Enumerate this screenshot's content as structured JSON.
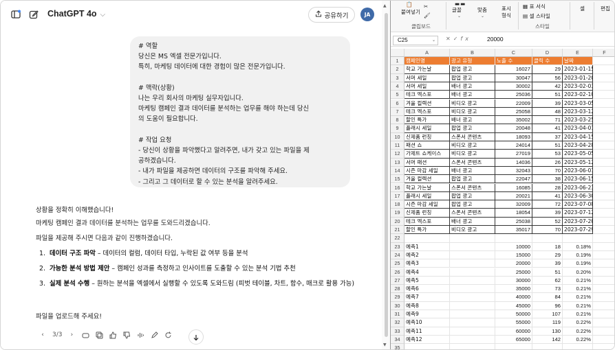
{
  "chat": {
    "model_name": "ChatGPT 4o",
    "share_label": "공유하기",
    "avatar_initials": "JA",
    "user_message_lines": [
      "# 역할",
      "당신은 MS 엑셀 전문가입니다.",
      "특히, 마케팅 데이터에 대한 경험이 많은 전문가입니다.",
      "",
      "# 맥락(상황)",
      "나는 우리 회사의 마케팅 실무자입니다.",
      "마케팅 캠페인 결과 데이터를 분석하는 업무를 해야 하는데 당신",
      "의 도움이 필요합니다.",
      "",
      "# 작업 요청",
      "- 당신이 상황을 파악했다고 알려주면, 내가 갖고 있는 파일을 제",
      "공하겠습니다.",
      "- 내가 파일을 제공하면 데이터의 구조를 파악해 주세요.",
      "- 그리고 그 데이터로 할 수 있는 분석을 알려주세요."
    ],
    "answer_intro_lines": [
      "상황을 정확히 이해했습니다!",
      "마케팅 캠페인 결과 데이터를 분석하는 업무를 도와드리겠습니다."
    ],
    "answer_plan_line": "파일을 제공해 주시면 다음과 같이 진행하겠습니다.",
    "answer_list": [
      {
        "num": "1.",
        "bold": "데이터 구조 파악",
        "rest": " – 데이터의 컬럼, 데이터 타입, 누락된 값 여부 등을 분석"
      },
      {
        "num": "2.",
        "bold": "가능한 분석 방법 제안",
        "rest": " – 캠페인 성과를 측정하고 인사이트를 도출할 수 있는 분석 기법 추천"
      },
      {
        "num": "3.",
        "bold": "실제 분석 수행",
        "rest": " – 원하는 분석을 엑셀에서 실행할 수 있도록 도와드림 (피벗 테이블, 차트, 함수, 매크로 활용 가능)"
      }
    ],
    "answer_closing": "파일을 업로드해 주세요!",
    "pager": "3/3"
  },
  "excel": {
    "ribbon": {
      "paste": "붙여넣기",
      "clipboard": "클립보드",
      "font": "글꼴",
      "align": "맞춤",
      "number_format_1": "표시",
      "number_format_2": "형식",
      "style_cond": "표 서식",
      "style_cell": "셀 스타일",
      "style_group": "스타일",
      "cells": "셀",
      "editing": "편집"
    },
    "name_box": "C25",
    "formula_value": "20000",
    "columns": [
      "A",
      "B",
      "C",
      "D",
      "E",
      "F"
    ],
    "header_row": [
      "캠페인명",
      "광고 유형",
      "노출 수",
      "클릭 수",
      "날짜"
    ],
    "data_rows": [
      [
        "학교 가는날",
        "팝업 광고",
        "16027",
        "29",
        "2023-01-15"
      ],
      [
        "서머 세일",
        "팝업 광고",
        "30047",
        "56",
        "2023-01-20"
      ],
      [
        "서머 세일",
        "배너 광고",
        "30002",
        "42",
        "2023-02-03"
      ],
      [
        "테크 엑스포",
        "배너 광고",
        "25036",
        "51",
        "2023-02-10"
      ],
      [
        "겨울 컬렉션",
        "비디오 광고",
        "22009",
        "39",
        "2023-03-05"
      ],
      [
        "테크 엑스포",
        "비디오 광고",
        "25058",
        "48",
        "2023-03-12"
      ],
      [
        "할인 특가",
        "배너 광고",
        "35002",
        "71",
        "2023-03-25"
      ],
      [
        "플래시 세일",
        "팝업 광고",
        "20048",
        "41",
        "2023-04-01"
      ],
      [
        "신제품 런칭",
        "스폰서 콘텐츠",
        "18093",
        "37",
        "2023-04-15"
      ],
      [
        "패션 쇼",
        "비디오 광고",
        "24014",
        "51",
        "2023-04-28"
      ],
      [
        "가제트 쇼케이스",
        "비디오 광고",
        "27019",
        "53",
        "2023-05-05"
      ],
      [
        "서머 패션",
        "스폰서 콘텐츠",
        "14036",
        "26",
        "2023-05-12"
      ],
      [
        "시즌 마감 세일",
        "배너 광고",
        "32043",
        "70",
        "2023-06-01"
      ],
      [
        "겨울 컬렉션",
        "팝업 광고",
        "22047",
        "38",
        "2023-06-15"
      ],
      [
        "학교 가는날",
        "스폰서 콘텐츠",
        "16085",
        "28",
        "2023-06-23"
      ],
      [
        "플래시 세일",
        "팝업 광고",
        "20021",
        "41",
        "2023-06-30"
      ],
      [
        "시즌 마감 세일",
        "팝업 광고",
        "32009",
        "72",
        "2023-07-08"
      ],
      [
        "신제품 런칭",
        "스폰서 콘텐츠",
        "18054",
        "39",
        "2023-07-12"
      ],
      [
        "테크 엑스포",
        "배너 광고",
        "25038",
        "52",
        "2023-07-20"
      ],
      [
        "할인 특가",
        "비디오 광고",
        "35017",
        "70",
        "2023-07-29"
      ]
    ],
    "forecast_rows": [
      [
        "예측1",
        "10000",
        "18",
        "0.18%"
      ],
      [
        "예측2",
        "15000",
        "29",
        "0.19%"
      ],
      [
        "예측3",
        "20000",
        "39",
        "0.19%"
      ],
      [
        "예측4",
        "25000",
        "51",
        "0.20%"
      ],
      [
        "예측5",
        "30000",
        "62",
        "0.21%"
      ],
      [
        "예측6",
        "35000",
        "73",
        "0.21%"
      ],
      [
        "예측7",
        "40000",
        "84",
        "0.21%"
      ],
      [
        "예측8",
        "45000",
        "96",
        "0.21%"
      ],
      [
        "예측9",
        "50000",
        "107",
        "0.21%"
      ],
      [
        "예측10",
        "55000",
        "119",
        "0.22%"
      ],
      [
        "예측11",
        "60000",
        "130",
        "0.22%"
      ],
      [
        "예측12",
        "65000",
        "142",
        "0.22%"
      ]
    ],
    "colors": {
      "header_fill": "#ed7d31"
    }
  }
}
